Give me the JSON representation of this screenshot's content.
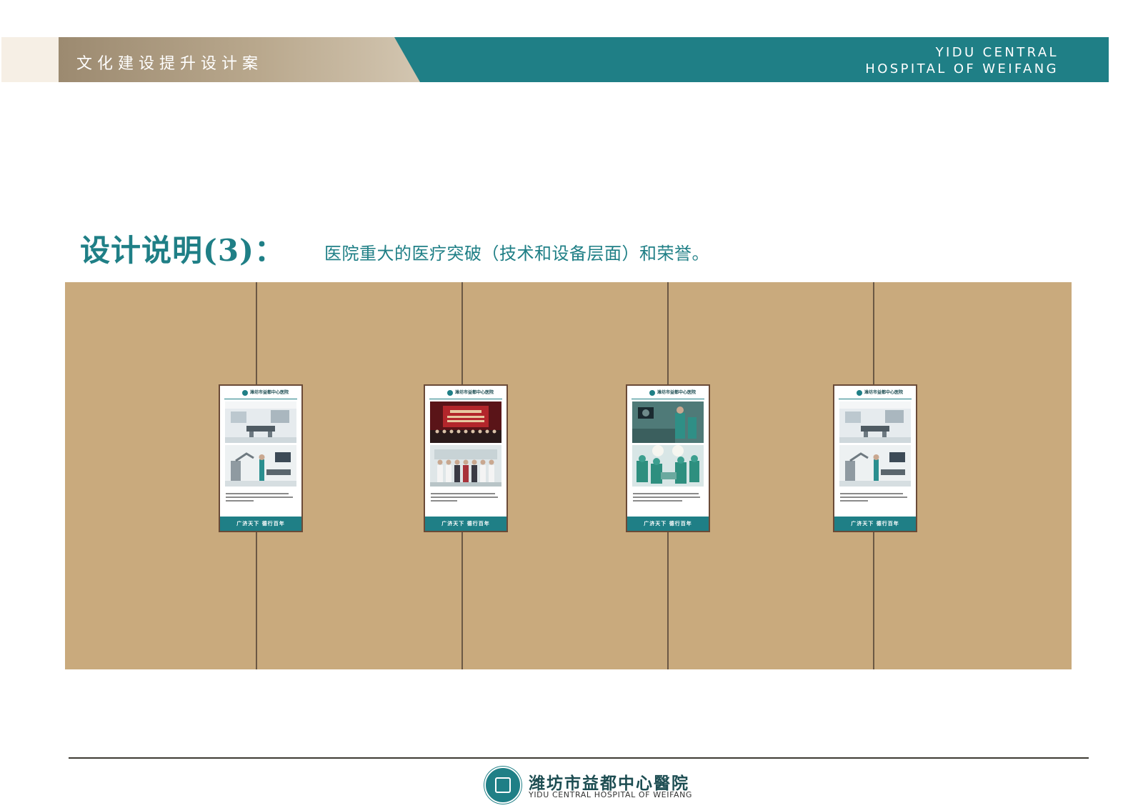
{
  "header": {
    "title": "文化建设提升设计案",
    "en_line1": "YIDU CENTRAL",
    "en_line2": "HOSPITAL OF WEIFANG"
  },
  "heading": {
    "title": "设计说明(3)：",
    "subtitle": "医院重大的医疗突破（技术和设备层面）和荣誉。"
  },
  "posters": [
    {
      "name": "潍坊市益都中心医院",
      "footer": "广济天下  德行百年",
      "photo_top": "operating-room",
      "photo_bottom": "robot-surgery-staff"
    },
    {
      "name": "潍坊市益都中心医院",
      "footer": "广济天下  德行百年",
      "photo_top": "award-ceremony-stage",
      "photo_bottom": "group-photo-doctors"
    },
    {
      "name": "潍坊市益都中心医院",
      "footer": "广济天下  德行百年",
      "photo_top": "surgery-team",
      "photo_bottom": "surgery-in-progress"
    },
    {
      "name": "潍坊市益都中心医院",
      "footer": "广济天下  德行百年",
      "photo_top": "operating-room",
      "photo_bottom": "robot-surgery-staff"
    }
  ],
  "footer": {
    "name_cn": "潍坊市益都中心醫院",
    "name_en": "YIDU CENTRAL HOSPITAL OF WEIFANG"
  },
  "colors": {
    "teal": "#1f7f86",
    "wall": "#c9aa7d",
    "frame": "#6a4a37"
  }
}
